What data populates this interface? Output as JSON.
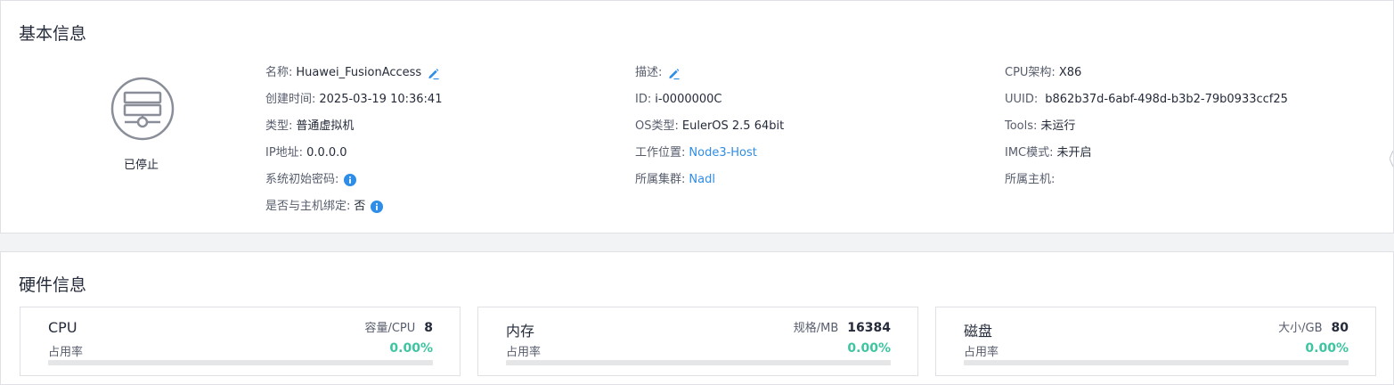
{
  "basic": {
    "title": "基本信息",
    "status": "已停止",
    "col1": {
      "name_label": "名称:",
      "name_value": "Huawei_FusionAccess",
      "created_label": "创建时间:",
      "created_value": "2025-03-19 10:36:41",
      "type_label": "类型:",
      "type_value": "普通虚拟机",
      "ip_label": "IP地址:",
      "ip_value": "0.0.0.0",
      "pwd_label": "系统初始密码:",
      "bind_label": "是否与主机绑定:",
      "bind_value": "否"
    },
    "col2": {
      "desc_label": "描述:",
      "id_label": "ID:",
      "id_value": "i-0000000C",
      "os_label": "OS类型:",
      "os_value": "EulerOS 2.5 64bit",
      "location_label": "工作位置:",
      "location_value": "Node3-Host",
      "cluster_label": "所属集群:",
      "cluster_value": "Nadl"
    },
    "col3": {
      "arch_label": "CPU架构:",
      "arch_value": "X86",
      "uuid_label": "UUID:",
      "uuid_value": "b862b37d-6abf-498d-b3b2-79b0933ccf25",
      "tools_label": "Tools:",
      "tools_value": "未运行",
      "imc_label": "IMC模式:",
      "imc_value": "未开启",
      "host_label": "所属主机:"
    }
  },
  "hardware": {
    "title": "硬件信息",
    "cards": [
      {
        "name": "CPU",
        "spec_label": "容量/CPU",
        "spec_value": "8",
        "usage_label": "占用率",
        "usage_value": "0.00%",
        "usage_fraction": 0
      },
      {
        "name": "内存",
        "spec_label": "规格/MB",
        "spec_value": "16384",
        "usage_label": "占用率",
        "usage_value": "0.00%",
        "usage_fraction": 0
      },
      {
        "name": "磁盘",
        "spec_label": "大小/GB",
        "spec_value": "80",
        "usage_label": "占用率",
        "usage_value": "0.00%",
        "usage_fraction": 0
      }
    ]
  },
  "colors": {
    "link": "#2e8de6",
    "usage_green": "#3fc4a1",
    "info_icon_blue": "#2e8de6"
  },
  "icons": {
    "vm": "vm-server-icon",
    "edit": "edit-pencil-icon",
    "info": "info-circle-icon"
  }
}
